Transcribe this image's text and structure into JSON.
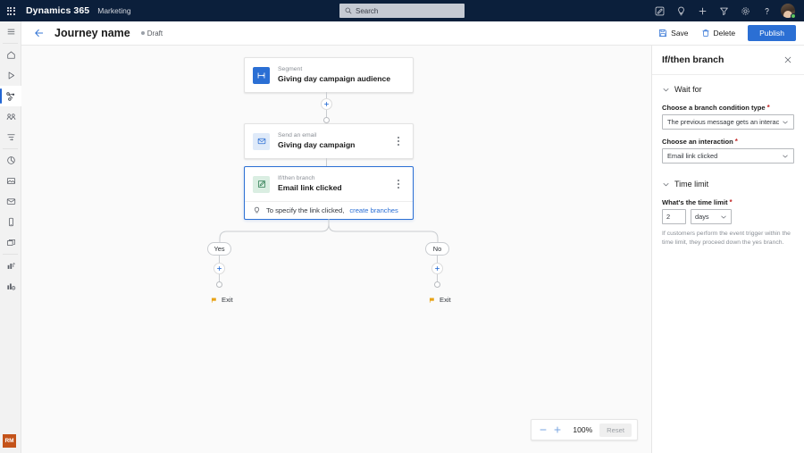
{
  "suitebar": {
    "waffle_label": "App launcher",
    "brand": "Dynamics 365",
    "app": "Marketing",
    "search_placeholder": "Search",
    "icons": [
      {
        "name": "edit-note-icon",
        "title": "Quick create"
      },
      {
        "name": "lightbulb-icon",
        "title": "Insights"
      },
      {
        "name": "plus-icon",
        "title": "New"
      },
      {
        "name": "filter-icon",
        "title": "Filter"
      },
      {
        "name": "gear-icon",
        "title": "Settings"
      },
      {
        "name": "help-icon",
        "title": "Help"
      }
    ],
    "avatar_name": "user-avatar",
    "presence": "available"
  },
  "rail": {
    "items": [
      {
        "name": "sidebar-item-menu",
        "icon": "hamburger-icon",
        "selected": false
      },
      {
        "name": "sidebar-item-home",
        "icon": "home-icon",
        "selected": false
      },
      {
        "name": "sidebar-item-recent",
        "icon": "recent-icon",
        "selected": false
      },
      {
        "name": "sidebar-item-journeys",
        "icon": "journey-icon",
        "selected": true
      },
      {
        "name": "sidebar-item-events",
        "icon": "events-icon",
        "selected": false
      },
      {
        "name": "sidebar-item-segments",
        "icon": "segments-icon",
        "selected": false
      },
      {
        "name": "sidebar-item-analytics",
        "icon": "analytics-icon",
        "selected": false
      },
      {
        "name": "sidebar-item-forms",
        "icon": "forms-icon",
        "selected": false
      },
      {
        "name": "sidebar-item-emails",
        "icon": "email-icon",
        "selected": false
      },
      {
        "name": "sidebar-item-mobile",
        "icon": "mobile-icon",
        "selected": false
      },
      {
        "name": "sidebar-item-pages",
        "icon": "pages-icon",
        "selected": false
      },
      {
        "name": "sidebar-item-reports",
        "icon": "reports-icon",
        "selected": false
      },
      {
        "name": "sidebar-item-insights",
        "icon": "insights-icon",
        "selected": false
      }
    ],
    "footer_badge": "RM"
  },
  "commandbar": {
    "back_label": "Back",
    "title": "Journey name",
    "status": "Draft",
    "save_label": "Save",
    "delete_label": "Delete",
    "publish_label": "Publish"
  },
  "canvas": {
    "nodes": [
      {
        "name": "node-segment",
        "kicker": "Segment",
        "title": "Giving day campaign audience",
        "icon": "segment-icon",
        "selected": false
      },
      {
        "name": "node-send-email",
        "kicker": "Send an email",
        "title": "Giving day campaign",
        "icon": "envelope-icon",
        "selected": false
      },
      {
        "name": "node-if-then-branch",
        "kicker": "If/then branch",
        "title": "Email link clicked",
        "icon": "branch-icon",
        "selected": true,
        "tip_text": "To specify the link clicked,",
        "tip_link": "create branches"
      }
    ],
    "branches": [
      {
        "name": "branch-yes",
        "label": "Yes",
        "exit_label": "Exit"
      },
      {
        "name": "branch-no",
        "label": "No",
        "exit_label": "Exit"
      }
    ],
    "zoom": {
      "out_label": "Zoom out",
      "in_label": "Zoom in",
      "level": "100%",
      "reset_label": "Reset"
    }
  },
  "panel": {
    "title": "If/then branch",
    "close_label": "Close",
    "sections": [
      {
        "name": "wait-for",
        "title": "Wait for",
        "fields": [
          {
            "label": "Choose a branch condition type",
            "required": true,
            "value": "The previous message gets an interaction"
          },
          {
            "label": "Choose an interaction",
            "required": true,
            "value": "Email link clicked"
          }
        ]
      },
      {
        "name": "time-limit",
        "title": "Time limit",
        "field_label": "What's the time limit",
        "required": true,
        "amount": "2",
        "unit": "days",
        "helper": "If customers perform the event trigger within the time limit, they proceed down the yes branch."
      }
    ]
  },
  "colors": {
    "suitebar_bg": "#0b1f3b",
    "accent": "#2b6fd4",
    "canvas_bg": "#fafafa",
    "required": "#c32b2b",
    "exit_flag": "#e8a317",
    "badge": "#c4531a"
  }
}
